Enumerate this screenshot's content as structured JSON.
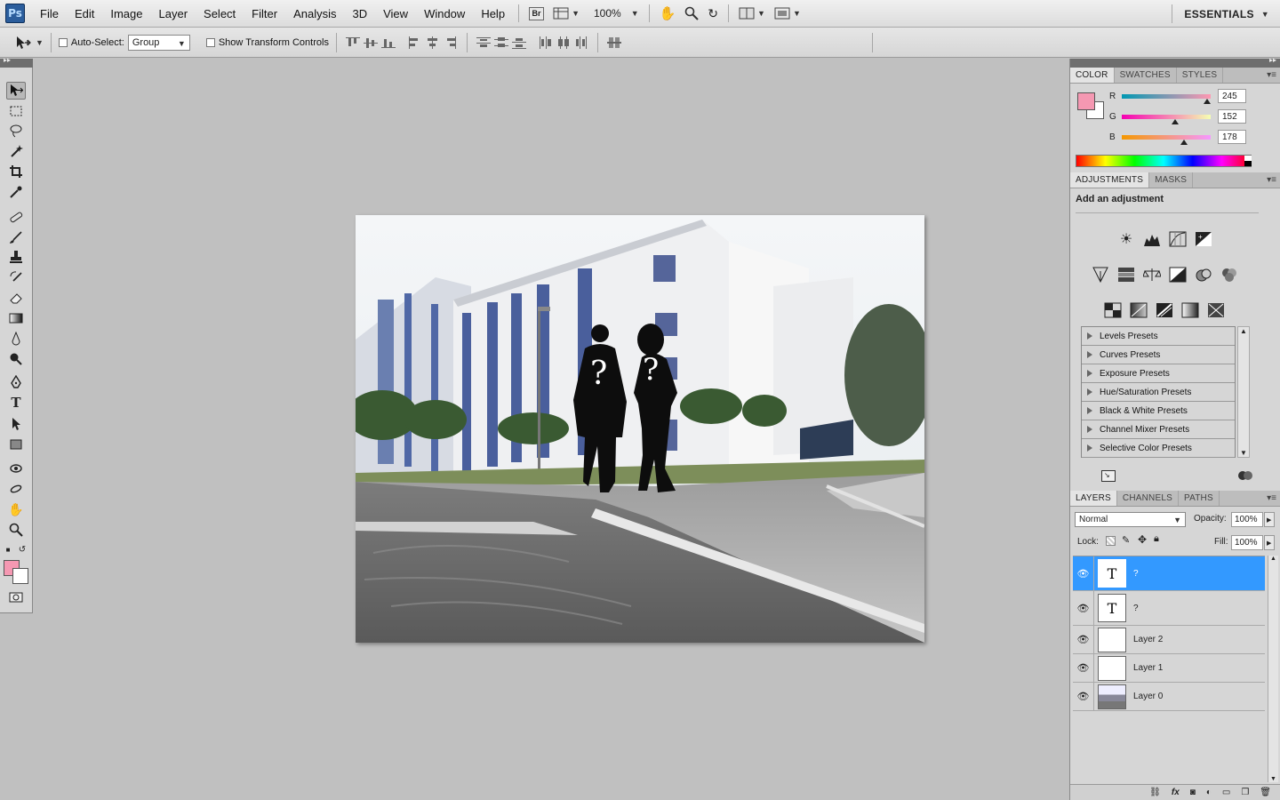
{
  "app": {
    "logo": "Ps",
    "workspace": "ESSENTIALS"
  },
  "menu": [
    "File",
    "Edit",
    "Image",
    "Layer",
    "Select",
    "Filter",
    "Analysis",
    "3D",
    "View",
    "Window",
    "Help"
  ],
  "menubar": {
    "bridge_label": "Br",
    "zoom": "100%"
  },
  "options": {
    "auto_select_label": "Auto-Select:",
    "auto_select_value": "Group",
    "show_transform_label": "Show Transform Controls"
  },
  "colors": {
    "foreground": "#f598b2",
    "background": "#ffffff",
    "selection": "#3399ff"
  },
  "color_panel": {
    "tabs": [
      "COLOR",
      "SWATCHES",
      "STYLES"
    ],
    "r_label": "R",
    "g_label": "G",
    "b_label": "B",
    "r": "245",
    "g": "152",
    "b": "178"
  },
  "adjustments_panel": {
    "tabs": [
      "ADJUSTMENTS",
      "MASKS"
    ],
    "heading": "Add an adjustment",
    "presets": [
      "Levels Presets",
      "Curves Presets",
      "Exposure Presets",
      "Hue/Saturation Presets",
      "Black & White Presets",
      "Channel Mixer Presets",
      "Selective Color Presets"
    ]
  },
  "layers_panel": {
    "tabs": [
      "LAYERS",
      "CHANNELS",
      "PATHS"
    ],
    "blend_mode": "Normal",
    "opacity_label": "Opacity:",
    "opacity": "100%",
    "lock_label": "Lock:",
    "fill_label": "Fill:",
    "fill": "100%",
    "layers": [
      {
        "name": "?",
        "type": "text",
        "selected": true
      },
      {
        "name": "?",
        "type": "text",
        "selected": false
      },
      {
        "name": "Layer 2",
        "type": "pixel",
        "selected": false
      },
      {
        "name": "Layer 1",
        "type": "pixel",
        "selected": false
      },
      {
        "name": "Layer 0",
        "type": "image",
        "selected": false
      }
    ]
  },
  "canvas": {
    "silhouette_mark": "?"
  }
}
